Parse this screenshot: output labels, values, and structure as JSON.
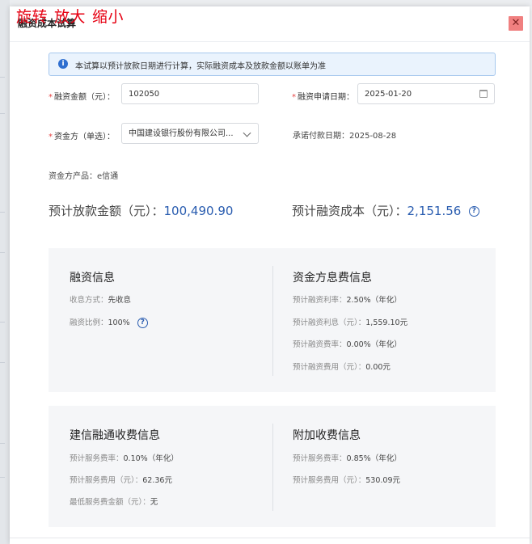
{
  "toolbar": {
    "rotate": "旋转",
    "zoom_in": "放大",
    "zoom_out": "缩小"
  },
  "dialog": {
    "title": "融资成本试算"
  },
  "notice": {
    "text": "本试算以预计放款日期进行计算，实际融资成本及放款金额以账单为准"
  },
  "form": {
    "amount_label": "融资金额（元）：",
    "amount_value": "102050",
    "date_label": "融资申请日期：",
    "date_value": "2025-01-20",
    "funder_label": "资金方（单选）：",
    "funder_value": "中国建设银行股份有限公司...",
    "promise_label": "承诺付款日期：",
    "promise_value": "2025-08-28",
    "product_label": "资金方产品：",
    "product_value": "e信通"
  },
  "summary": {
    "disburse_label": "预计放款金额（元）：",
    "disburse_value": "100,490.90",
    "cost_label": "预计融资成本（元）：",
    "cost_value": "2,151.56"
  },
  "financing_info": {
    "title": "融资信息",
    "rows": [
      {
        "k": "收息方式：",
        "v": "先收息"
      },
      {
        "k": "融资比例：",
        "v": "100%"
      }
    ]
  },
  "funder_fee_info": {
    "title": "资金方息费信息",
    "rows": [
      {
        "k": "预计融资利率：",
        "v": "2.50%（年化）"
      },
      {
        "k": "预计融资利息（元）：",
        "v": "1,559.10元"
      },
      {
        "k": "预计融资费率：",
        "v": "0.00%（年化）"
      },
      {
        "k": "预计融资费用（元）：",
        "v": "0.00元"
      }
    ]
  },
  "ccb_fee_info": {
    "title": "建信融通收费信息",
    "rows": [
      {
        "k": "预计服务费率：",
        "v": "0.10%（年化）"
      },
      {
        "k": "预计服务费用（元）：",
        "v": "62.36元"
      },
      {
        "k": "最低服务费金额（元）：",
        "v": "无"
      }
    ]
  },
  "extra_fee_info": {
    "title": "附加收费信息",
    "rows": [
      {
        "k": "预计服务费率：",
        "v": "0.85%（年化）"
      },
      {
        "k": "预计服务费用（元）：",
        "v": "530.09元"
      }
    ]
  },
  "icons": {
    "help": "?",
    "info": "i",
    "close": "✕"
  }
}
